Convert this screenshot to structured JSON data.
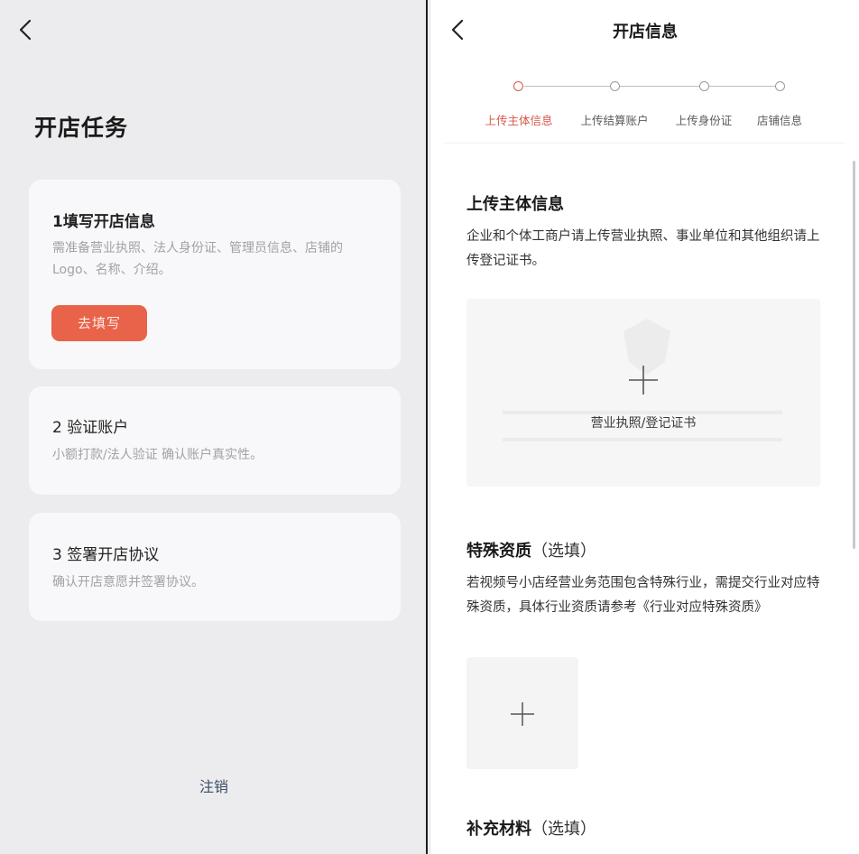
{
  "left": {
    "title": "开店任务",
    "tasks": [
      {
        "title": "1填写开店信息",
        "description": "需准备营业执照、法人身份证、管理员信息、店铺的Logo、名称、介绍。",
        "button": "去填写"
      },
      {
        "title": "2 验证账户",
        "description": "小额打款/法人验证 确认账户真实性。"
      },
      {
        "title": "3 签署开店协议",
        "description": "确认开店意愿并签署协议。"
      }
    ],
    "logout": "注销"
  },
  "right": {
    "nav_title": "开店信息",
    "steps": [
      "上传主体信息",
      "上传结算账户",
      "上传身份证",
      "店铺信息"
    ],
    "current_step": 1,
    "sections": {
      "main": {
        "title": "上传主体信息",
        "description": "企业和个体工商户请上传营业执照、事业单位和其他组织请上传登记证书。",
        "upload_label": "营业执照/登记证书"
      },
      "special": {
        "title": "特殊资质",
        "optional": "（选填）",
        "description": "若视频号小店经营业务范围包含特殊行业，需提交行业对应特殊资质，具体行业资质请参考《行业对应特殊资质》"
      },
      "supplement": {
        "title": "补充材料",
        "optional": "（选填）"
      }
    }
  },
  "colors": {
    "accent": "#e8634a",
    "step_active": "#d9574a",
    "logout_text": "#3c4d66"
  },
  "icons": [
    "chevron-left-icon",
    "plus-icon",
    "shield-icon"
  ]
}
